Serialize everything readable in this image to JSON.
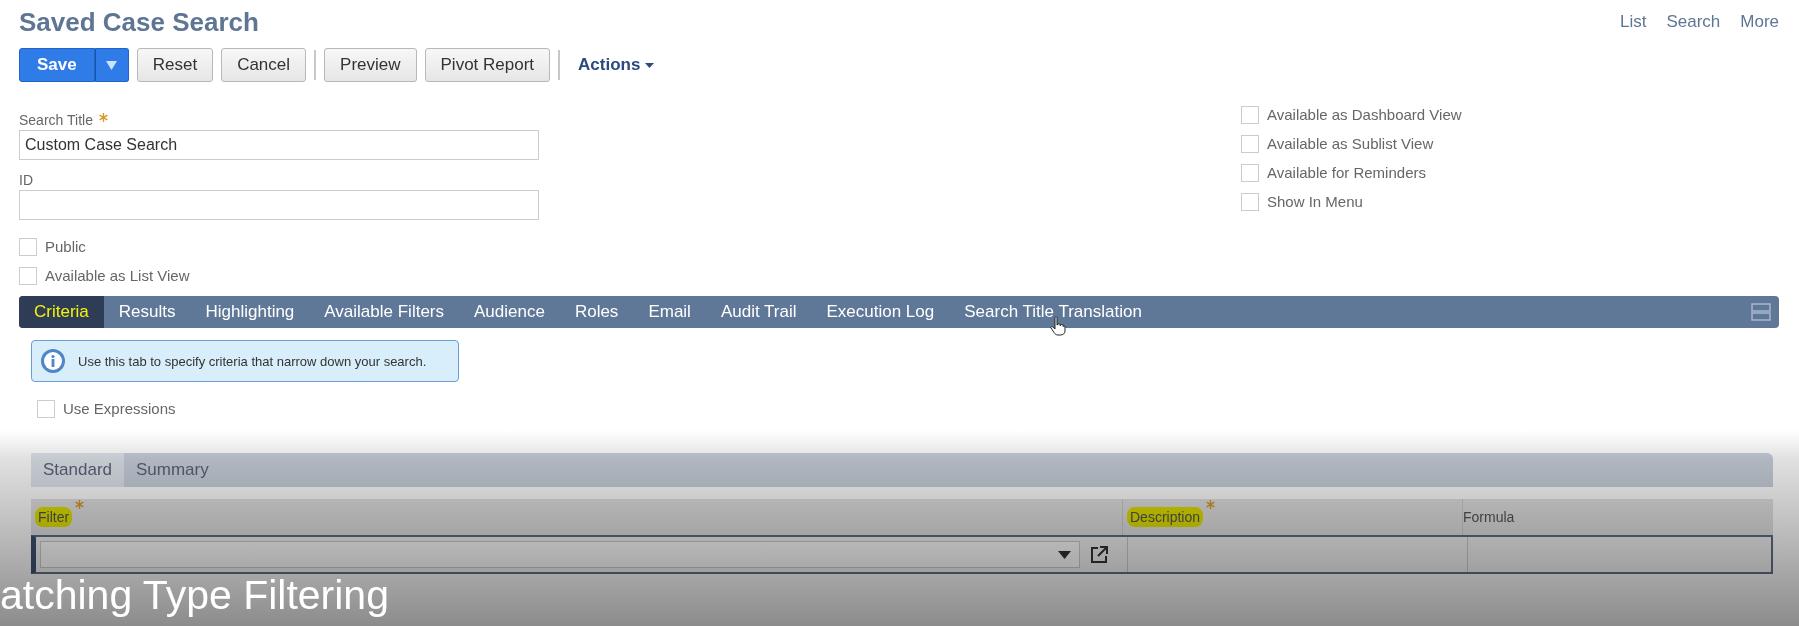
{
  "page": {
    "title": "Saved Case Search",
    "nav_links": [
      "List",
      "Search",
      "More"
    ]
  },
  "toolbar": {
    "save": "Save",
    "buttons": [
      "Reset",
      "Cancel",
      "Preview",
      "Pivot Report"
    ],
    "actions": "Actions"
  },
  "fields": [
    {
      "label": "Search Title",
      "required": true,
      "value": "Custom Case Search"
    },
    {
      "label": "ID",
      "required": false
    }
  ],
  "left_checkboxes": [
    {
      "label": "Public",
      "checked": false
    },
    {
      "label": "Available as List View",
      "checked": false
    }
  ],
  "right_checkboxes": [
    {
      "label": "Available as Dashboard View",
      "checked": false
    },
    {
      "label": "Available as Sublist View",
      "checked": false
    },
    {
      "label": "Available for Reminders",
      "checked": false
    },
    {
      "label": "Show In Menu",
      "checked": false
    }
  ],
  "tabs": [
    {
      "label": "Criteria",
      "selected": true,
      "highlighted": true
    },
    {
      "label": "Results",
      "selected": false,
      "highlighted": false
    },
    {
      "label": "Highlighting",
      "selected": false,
      "highlighted": false
    },
    {
      "label": "Available Filters",
      "selected": false,
      "highlighted": false
    },
    {
      "label": "Audience",
      "selected": false,
      "highlighted": false
    },
    {
      "label": "Roles",
      "selected": false,
      "highlighted": false
    },
    {
      "label": "Email",
      "selected": false,
      "highlighted": false
    },
    {
      "label": "Audit Trail",
      "selected": false,
      "highlighted": false
    },
    {
      "label": "Execution Log",
      "selected": false,
      "highlighted": false
    },
    {
      "label": "Search Title Translation",
      "selected": false,
      "highlighted": false
    }
  ],
  "info": "Use this tab to specify criteria that narrow down your search.",
  "use_expressions": {
    "label": "Use Expressions",
    "checked": false
  },
  "subtabs": [
    {
      "label": "Standard",
      "selected": true
    },
    {
      "label": "Summary",
      "selected": false
    }
  ],
  "table": {
    "columns": [
      {
        "label": "Filter",
        "required": true,
        "highlighted": true
      },
      {
        "label": "Description",
        "required": true,
        "highlighted": true
      },
      {
        "label": "Formula",
        "required": false,
        "highlighted": false
      }
    ]
  },
  "caption": "atching Type Filtering"
}
